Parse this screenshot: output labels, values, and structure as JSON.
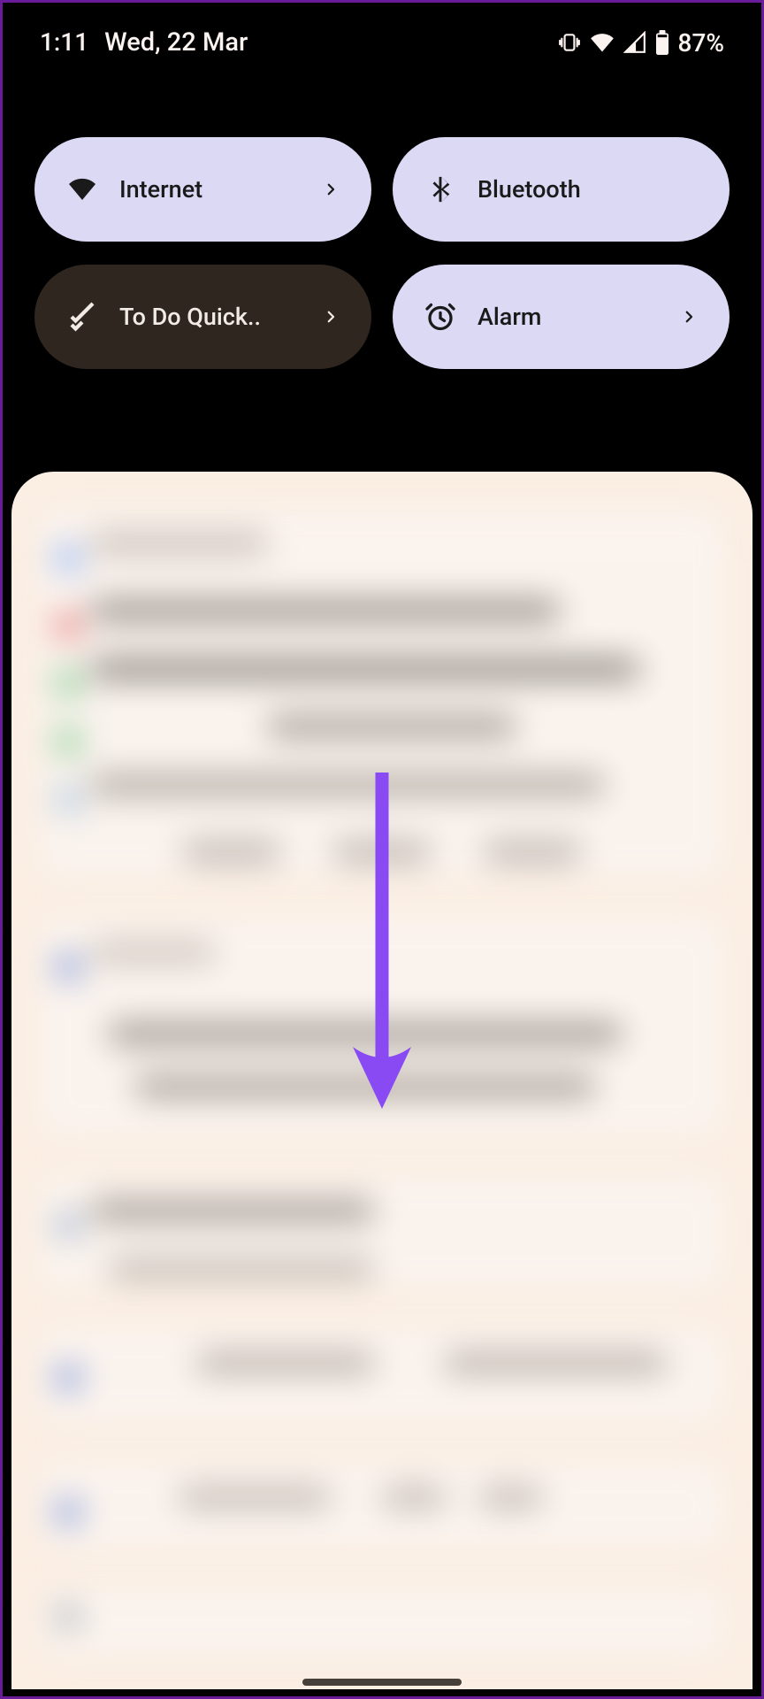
{
  "status": {
    "time": "1:11",
    "date": "Wed, 22 Mar",
    "battery": "87%"
  },
  "qs": {
    "tiles": [
      {
        "label": "Internet",
        "icon": "wifi-icon",
        "active": true,
        "chevron": true
      },
      {
        "label": "Bluetooth",
        "icon": "bluetooth-icon",
        "active": true,
        "chevron": false
      },
      {
        "label": "To Do Quick..",
        "icon": "checklist-icon",
        "active": false,
        "chevron": true
      },
      {
        "label": "Alarm",
        "icon": "alarm-icon",
        "active": true,
        "chevron": true
      }
    ]
  },
  "annotation": {
    "arrow_color": "#8a4af3"
  }
}
